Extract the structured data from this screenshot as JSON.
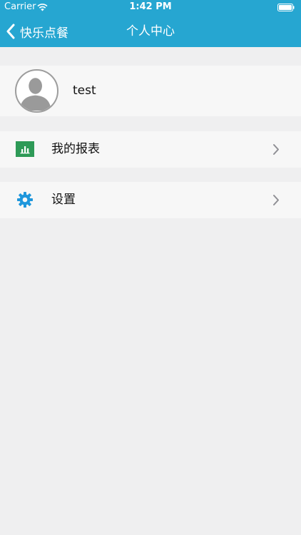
{
  "status_bar": {
    "carrier": "Carrier",
    "time": "1:42 PM"
  },
  "nav": {
    "back_label": "快乐点餐",
    "title": "个人中心"
  },
  "profile": {
    "username": "test"
  },
  "menu": {
    "items": [
      {
        "label": "我的报表",
        "icon": "report-chart-icon"
      },
      {
        "label": "设置",
        "icon": "gear-icon"
      }
    ]
  },
  "colors": {
    "header_bg": "#26a6d1",
    "page_bg": "#efeff0",
    "row_bg": "#f7f7f7",
    "report_icon": "#2e9a57",
    "gear_icon": "#1f97dc"
  }
}
